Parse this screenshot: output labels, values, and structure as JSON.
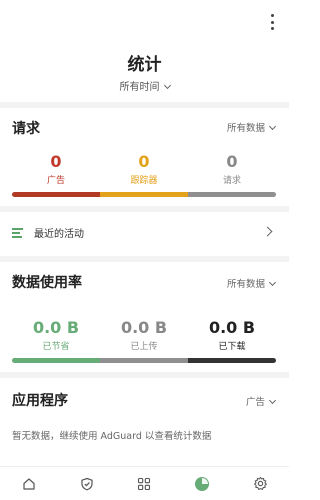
{
  "header": {
    "title": "统计",
    "period": "所有时间"
  },
  "requests": {
    "title": "请求",
    "filter": "所有数据",
    "stats": [
      {
        "value": "0",
        "label": "广告",
        "color": "#c0392b"
      },
      {
        "value": "0",
        "label": "跟踪器",
        "color": "#e5a21c"
      },
      {
        "value": "0",
        "label": "请求",
        "color": "#888888"
      }
    ],
    "bar_colors": [
      "#b23a25",
      "#e4a11b",
      "#8f8f8f"
    ]
  },
  "recent_activity": {
    "label": "最近的活动"
  },
  "data_usage": {
    "title": "数据使用率",
    "filter": "所有数据",
    "stats": [
      {
        "value": "0.0 B",
        "label": "已节省",
        "color": "#67ab77"
      },
      {
        "value": "0.0 B",
        "label": "已上传",
        "color": "#888888"
      },
      {
        "value": "0.0 B",
        "label": "已下载",
        "color": "#222222"
      }
    ],
    "bar_colors": [
      "#67ab77",
      "#8f8f8f",
      "#333333"
    ]
  },
  "apps": {
    "title": "应用程序",
    "filter": "广告",
    "empty_text": "暂无数据，继续使用 AdGuard 以查看统计数据"
  },
  "bottom_nav": {
    "items": [
      "home-icon",
      "shield-icon",
      "apps-grid-icon",
      "statistics-icon",
      "settings-icon"
    ],
    "active_color": "#67ab77"
  }
}
